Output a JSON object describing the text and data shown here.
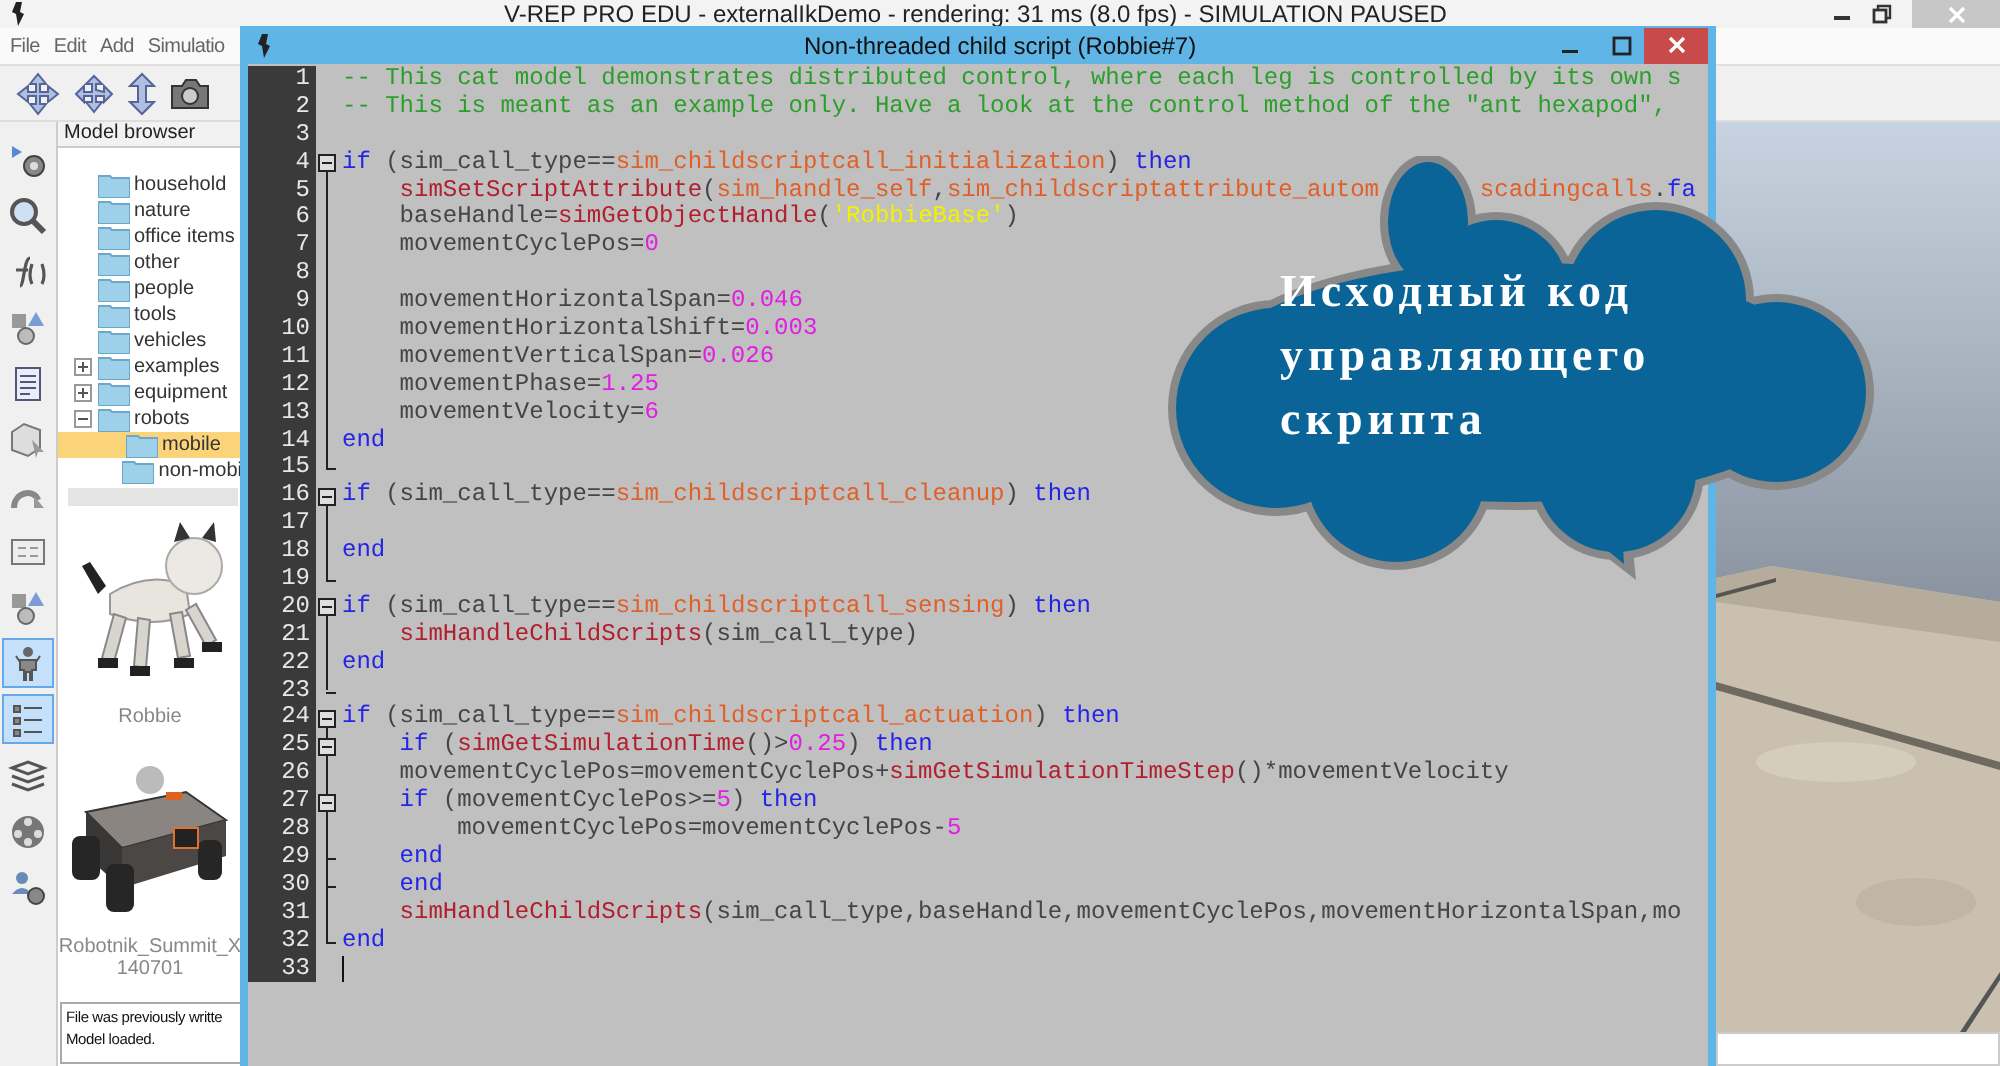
{
  "app": {
    "title": "V-REP PRO EDU - externalIkDemo - rendering: 31 ms (8.0 fps) - SIMULATION PAUSED",
    "menu": [
      "File",
      "Edit",
      "Add",
      "Simulatio"
    ]
  },
  "left_toolbar": [
    {
      "selected": false
    },
    {
      "selected": false
    },
    {
      "selected": false
    },
    {
      "selected": false
    },
    {
      "selected": false
    },
    {
      "selected": false
    },
    {
      "selected": false
    },
    {
      "selected": false
    },
    {
      "selected": false
    },
    {
      "selected": true
    },
    {
      "selected": true
    },
    {
      "selected": false
    },
    {
      "selected": false
    },
    {
      "selected": false
    }
  ],
  "model_browser": {
    "title": "Model browser",
    "tree": [
      {
        "label": "household",
        "selected": false
      },
      {
        "label": "nature",
        "selected": false
      },
      {
        "label": "office items",
        "selected": false
      },
      {
        "label": "other",
        "selected": false
      },
      {
        "label": "people",
        "selected": false
      },
      {
        "label": "tools",
        "selected": false
      },
      {
        "label": "vehicles",
        "selected": false
      },
      {
        "label": "examples",
        "selected": false,
        "expanded": false
      },
      {
        "label": "equipment",
        "selected": false,
        "expanded": false
      },
      {
        "label": "robots",
        "selected": false,
        "expanded": true,
        "children": [
          {
            "label": "mobile",
            "selected": true
          },
          {
            "label": "non-mobi",
            "selected": false
          }
        ]
      }
    ],
    "models": [
      {
        "name": "Robbie",
        "kind": "cat"
      },
      {
        "name": "Robotnik_Summit_X",
        "name_line2": "140701",
        "kind": "rover"
      }
    ],
    "status": [
      "File was previously writte",
      "Model loaded."
    ]
  },
  "editor": {
    "title": "Non-threaded child script (Robbie#7)",
    "lines": [
      {
        "number": "1",
        "tokens": [
          {
            "kind": "comment",
            "text": "-- This cat model demonstrates distributed control, where each leg is controlled by its own s"
          }
        ]
      },
      {
        "number": "2",
        "tokens": [
          {
            "kind": "comment",
            "text": "-- This is meant as an example only. Have a look at the control method of the \"ant hexapod\","
          }
        ]
      },
      {
        "number": "3"
      },
      {
        "number": "4",
        "fold": {
          "kind": "start"
        },
        "tokens": [
          {
            "kind": "keyword",
            "text": "if"
          },
          {
            "kind": "plain",
            "text": " (sim_call_type=="
          },
          {
            "kind": "constant",
            "text": "sim_childscriptcall_initialization"
          },
          {
            "kind": "plain",
            "text": ") "
          },
          {
            "kind": "keyword",
            "text": "then"
          }
        ]
      },
      {
        "number": "5",
        "fold": {
          "kind": "middle"
        },
        "tokens": [
          {
            "kind": "function",
            "text": "    simSetScriptAttribute"
          },
          {
            "kind": "plain",
            "text": "("
          },
          {
            "kind": "constant",
            "text": "sim_handle_self"
          },
          {
            "kind": "plain",
            "text": ","
          },
          {
            "kind": "constant",
            "text": "sim_childscriptattribute_autom"
          },
          {
            "kind": "gap"
          },
          {
            "kind": "constant",
            "text": "scadingcalls"
          },
          {
            "kind": "plain",
            "text": "."
          },
          {
            "kind": "keyword",
            "text": "fa"
          }
        ]
      },
      {
        "number": "6",
        "fold": {
          "kind": "middle"
        },
        "tokens": [
          {
            "kind": "plain",
            "text": "    baseHandle="
          },
          {
            "kind": "function",
            "text": "simGetObjectHandle"
          },
          {
            "kind": "plain",
            "text": "("
          },
          {
            "kind": "string",
            "text": "'RobbieBase'"
          },
          {
            "kind": "plain",
            "text": ")"
          }
        ]
      },
      {
        "number": "7",
        "fold": {
          "kind": "middle"
        },
        "tokens": [
          {
            "kind": "plain",
            "text": "    movementCyclePos="
          },
          {
            "kind": "number",
            "text": "0"
          }
        ]
      },
      {
        "number": "8",
        "fold": {
          "kind": "middle"
        }
      },
      {
        "number": "9",
        "fold": {
          "kind": "middle"
        },
        "tokens": [
          {
            "kind": "plain",
            "text": "    movementHorizontalSpan="
          },
          {
            "kind": "number",
            "text": "0.046"
          }
        ]
      },
      {
        "number": "10",
        "fold": {
          "kind": "middle"
        },
        "tokens": [
          {
            "kind": "plain",
            "text": "    movementHorizontalShift="
          },
          {
            "kind": "number",
            "text": "0.003"
          }
        ]
      },
      {
        "number": "11",
        "fold": {
          "kind": "middle"
        },
        "tokens": [
          {
            "kind": "plain",
            "text": "    movementVerticalSpan="
          },
          {
            "kind": "number",
            "text": "0.026"
          }
        ]
      },
      {
        "number": "12",
        "fold": {
          "kind": "middle"
        },
        "tokens": [
          {
            "kind": "plain",
            "text": "    movementPhase="
          },
          {
            "kind": "number",
            "text": "1.25"
          }
        ]
      },
      {
        "number": "13",
        "fold": {
          "kind": "middle"
        },
        "tokens": [
          {
            "kind": "plain",
            "text": "    movementVelocity="
          },
          {
            "kind": "number",
            "text": "6"
          }
        ]
      },
      {
        "number": "14",
        "fold": {
          "kind": "middle"
        },
        "tokens": [
          {
            "kind": "keyword",
            "text": "end"
          }
        ]
      },
      {
        "number": "15",
        "fold": {
          "kind": "end"
        }
      },
      {
        "number": "16",
        "fold": {
          "kind": "start"
        },
        "tokens": [
          {
            "kind": "keyword",
            "text": "if"
          },
          {
            "kind": "plain",
            "text": " (sim_call_type=="
          },
          {
            "kind": "constant",
            "text": "sim_childscriptcall_cleanup"
          },
          {
            "kind": "plain",
            "text": ") "
          },
          {
            "kind": "keyword",
            "text": "then"
          }
        ]
      },
      {
        "number": "17",
        "fold": {
          "kind": "middle"
        }
      },
      {
        "number": "18",
        "fold": {
          "kind": "middle"
        },
        "tokens": [
          {
            "kind": "keyword",
            "text": "end"
          }
        ]
      },
      {
        "number": "19",
        "fold": {
          "kind": "end"
        }
      },
      {
        "number": "20",
        "fold": {
          "kind": "start"
        },
        "tokens": [
          {
            "kind": "keyword",
            "text": "if"
          },
          {
            "kind": "plain",
            "text": " (sim_call_type=="
          },
          {
            "kind": "constant",
            "text": "sim_childscriptcall_sensing"
          },
          {
            "kind": "plain",
            "text": ") "
          },
          {
            "kind": "keyword",
            "text": "then"
          }
        ]
      },
      {
        "number": "21",
        "fold": {
          "kind": "middle"
        },
        "tokens": [
          {
            "kind": "function",
            "text": "    simHandleChildScripts"
          },
          {
            "kind": "plain",
            "text": "(sim_call_type)"
          }
        ]
      },
      {
        "number": "22",
        "fold": {
          "kind": "middle"
        },
        "tokens": [
          {
            "kind": "keyword",
            "text": "end"
          }
        ]
      },
      {
        "number": "23",
        "fold": {
          "kind": "end"
        }
      },
      {
        "number": "24",
        "fold": {
          "kind": "start"
        },
        "tokens": [
          {
            "kind": "keyword",
            "text": "if"
          },
          {
            "kind": "plain",
            "text": " (sim_call_type=="
          },
          {
            "kind": "constant",
            "text": "sim_childscriptcall_actuation"
          },
          {
            "kind": "plain",
            "text": ") "
          },
          {
            "kind": "keyword",
            "text": "then"
          }
        ]
      },
      {
        "number": "25",
        "fold": {
          "kind": "start"
        },
        "tokens": [
          {
            "kind": "keyword",
            "text": "    if"
          },
          {
            "kind": "plain",
            "text": " ("
          },
          {
            "kind": "function",
            "text": "simGetSimulationTime"
          },
          {
            "kind": "plain",
            "text": "()>"
          },
          {
            "kind": "number",
            "text": "0.25"
          },
          {
            "kind": "plain",
            "text": ") "
          },
          {
            "kind": "keyword",
            "text": "then"
          }
        ]
      },
      {
        "number": "26",
        "fold": {
          "kind": "middle"
        },
        "tokens": [
          {
            "kind": "plain",
            "text": "    movementCyclePos=movementCyclePos+"
          },
          {
            "kind": "function",
            "text": "simGetSimulationTimeStep"
          },
          {
            "kind": "plain",
            "text": "()*movementVelocity"
          }
        ]
      },
      {
        "number": "27",
        "fold": {
          "kind": "start"
        },
        "tokens": [
          {
            "kind": "keyword",
            "text": "    if"
          },
          {
            "kind": "plain",
            "text": " (movementCyclePos>="
          },
          {
            "kind": "number",
            "text": "5"
          },
          {
            "kind": "plain",
            "text": ") "
          },
          {
            "kind": "keyword",
            "text": "then"
          }
        ]
      },
      {
        "number": "28",
        "fold": {
          "kind": "middle"
        },
        "tokens": [
          {
            "kind": "plain",
            "text": "        movementCyclePos=movementCyclePos-"
          },
          {
            "kind": "number",
            "text": "5"
          }
        ]
      },
      {
        "number": "29",
        "fold": {
          "kind": "tick"
        },
        "tokens": [
          {
            "kind": "keyword",
            "text": "    end"
          }
        ]
      },
      {
        "number": "30",
        "fold": {
          "kind": "tick"
        },
        "tokens": [
          {
            "kind": "keyword",
            "text": "    end"
          }
        ]
      },
      {
        "number": "31",
        "fold": {
          "kind": "middle"
        },
        "tokens": [
          {
            "kind": "function",
            "text": "    simHandleChildScripts"
          },
          {
            "kind": "plain",
            "text": "(sim_call_type,baseHandle,movementCyclePos,movementHorizontalSpan,mo"
          }
        ]
      },
      {
        "number": "32",
        "fold": {
          "kind": "end"
        },
        "tokens": [
          {
            "kind": "keyword",
            "text": "end"
          }
        ]
      },
      {
        "number": "33",
        "caret": true
      }
    ]
  },
  "callout": {
    "lines": [
      "Исходный код",
      "управляющего",
      "скрипта"
    ]
  }
}
